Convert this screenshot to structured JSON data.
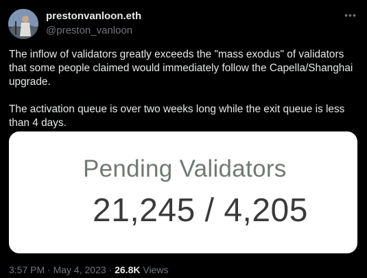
{
  "author": {
    "display_name": "prestonvanloon.eth",
    "handle": "@preston_vanloon",
    "avatar": "profile-photo"
  },
  "more_icon": "ellipsis-icon",
  "tweet": {
    "paragraph_1": "The inflow of validators greatly exceeds the \"mass exodus\" of validators that some people claimed would immediately follow the Capella/Shanghai upgrade.",
    "paragraph_2": "The activation queue is over two weeks long while the exit queue is less than 4 days."
  },
  "media": {
    "title": "Pending Validators",
    "value": "21,245 / 4,205"
  },
  "meta": {
    "time": "3:57 PM",
    "separator_1": "·",
    "date": "May 4, 2023",
    "separator_2": "·",
    "views_count": "26.8K",
    "views_label": "Views"
  }
}
